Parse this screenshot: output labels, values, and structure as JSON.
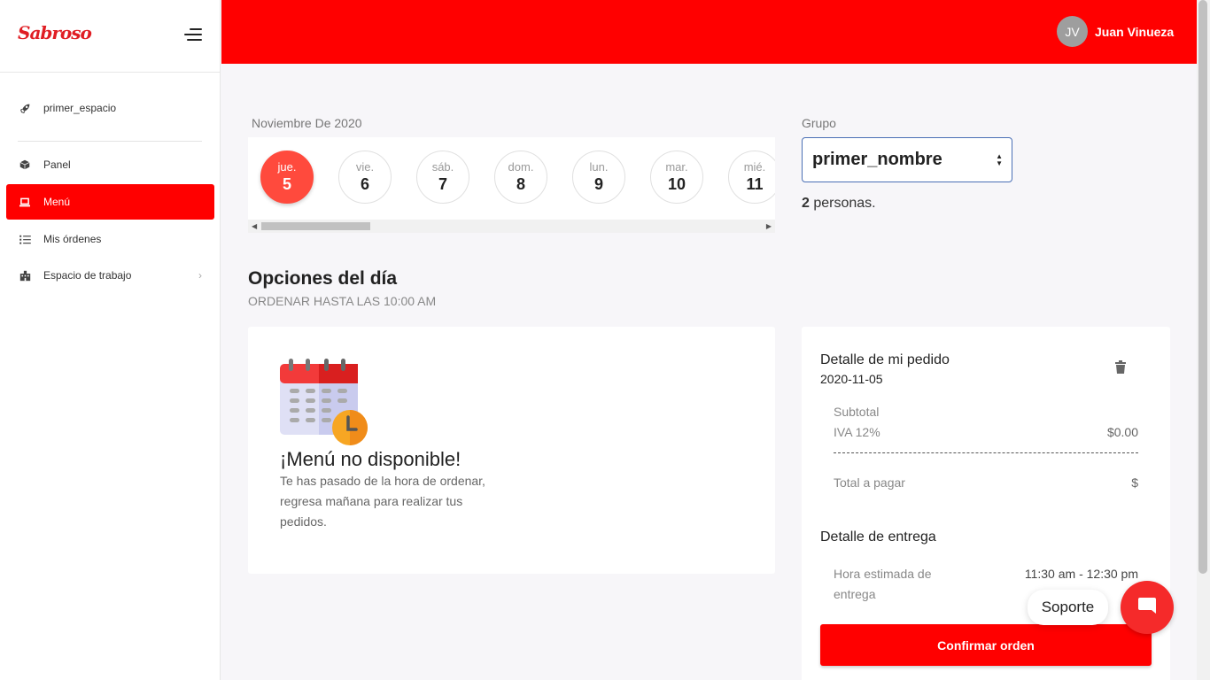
{
  "brand": {
    "logo_text": "Sabroso"
  },
  "colors": {
    "primary": "#ff0000",
    "selected_day": "#ff4a3d",
    "chat": "#f52a2a"
  },
  "sidebar": {
    "workspace": {
      "label": "primer_espacio",
      "icon": "rocket-icon"
    },
    "items": [
      {
        "label": "Panel",
        "icon": "box-icon"
      },
      {
        "label": "Menú",
        "icon": "laptop-icon",
        "active": true
      },
      {
        "label": "Mis órdenes",
        "icon": "list-icon"
      },
      {
        "label": "Espacio de trabajo",
        "icon": "building-icon",
        "has_submenu": true
      }
    ]
  },
  "header": {
    "avatar_initials": "JV",
    "user_name": "Juan Vinueza"
  },
  "calendar": {
    "month_label": "Noviembre De 2020",
    "days": [
      {
        "name": "jue.",
        "num": "5",
        "selected": true
      },
      {
        "name": "vie.",
        "num": "6"
      },
      {
        "name": "sáb.",
        "num": "7"
      },
      {
        "name": "dom.",
        "num": "8"
      },
      {
        "name": "lun.",
        "num": "9"
      },
      {
        "name": "mar.",
        "num": "10"
      },
      {
        "name": "mié.",
        "num": "11"
      }
    ]
  },
  "group": {
    "label": "Grupo",
    "selected": "primer_nombre",
    "people_count": "2",
    "people_suffix": " personas."
  },
  "options": {
    "title": "Opciones del día",
    "subtitle": "ORDENAR HASTA LAS 10:00 AM"
  },
  "menu_unavailable": {
    "title": "¡Menú no disponible!",
    "text": "Te has pasado de la hora de ordenar, regresa mañana para realizar tus pedidos."
  },
  "order": {
    "title": "Detalle de mi pedido",
    "date": "2020-11-05",
    "subtotal_label": "Subtotal",
    "subtotal_value": "",
    "iva_label": "IVA 12%",
    "iva_value": "$0.00",
    "total_label": "Total a pagar",
    "total_value": "$",
    "delivery_title": "Detalle de entrega",
    "delivery_time_label": "Hora estimada de entrega",
    "delivery_time_value": "11:30 am - 12:30 pm",
    "confirm_label": "Confirmar orden"
  },
  "support": {
    "label": "Soporte"
  }
}
